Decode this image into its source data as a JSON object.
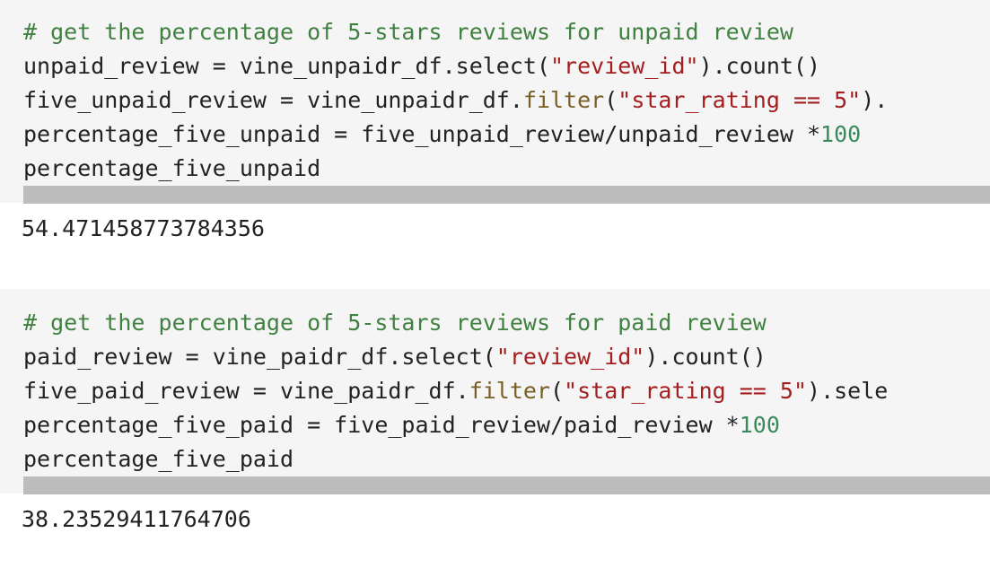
{
  "cells": [
    {
      "lines": [
        [
          {
            "t": "# get the percentage of 5-stars reviews for unpaid review",
            "c": "cm"
          }
        ],
        [
          {
            "t": "unpaid_review = vine_unpaidr_df.select(",
            "c": ""
          },
          {
            "t": "\"review_id\"",
            "c": "st"
          },
          {
            "t": ").count()",
            "c": ""
          }
        ],
        [
          {
            "t": "five_unpaid_review = vine_unpaidr_df.",
            "c": ""
          },
          {
            "t": "filter",
            "c": "fn"
          },
          {
            "t": "(",
            "c": ""
          },
          {
            "t": "\"star_rating == 5\"",
            "c": "st"
          },
          {
            "t": ").",
            "c": ""
          }
        ],
        [
          {
            "t": "percentage_five_unpaid = five_unpaid_review/unpaid_review *",
            "c": ""
          },
          {
            "t": "100",
            "c": "nm"
          }
        ],
        [
          {
            "t": "percentage_five_unpaid",
            "c": ""
          }
        ]
      ],
      "output": "54.471458773784356"
    },
    {
      "lines": [
        [
          {
            "t": "# get the percentage of 5-stars reviews for paid review",
            "c": "cm"
          }
        ],
        [
          {
            "t": "paid_review = vine_paidr_df.select(",
            "c": ""
          },
          {
            "t": "\"review_id\"",
            "c": "st"
          },
          {
            "t": ").count()",
            "c": ""
          }
        ],
        [
          {
            "t": "five_paid_review = vine_paidr_df.",
            "c": ""
          },
          {
            "t": "filter",
            "c": "fn"
          },
          {
            "t": "(",
            "c": ""
          },
          {
            "t": "\"star_rating == 5\"",
            "c": "st"
          },
          {
            "t": ").sele",
            "c": ""
          }
        ],
        [
          {
            "t": "percentage_five_paid = five_paid_review/paid_review *",
            "c": ""
          },
          {
            "t": "100",
            "c": "nm"
          }
        ],
        [
          {
            "t": "percentage_five_paid",
            "c": ""
          }
        ]
      ],
      "output": "38.23529411764706"
    }
  ],
  "colors": {
    "code_background": "#f5f5f5",
    "comment": "#408040",
    "string": "#a31f1f",
    "function": "#795e26",
    "number": "#3a8a5c",
    "scrollbar": "#bcbcbc"
  }
}
